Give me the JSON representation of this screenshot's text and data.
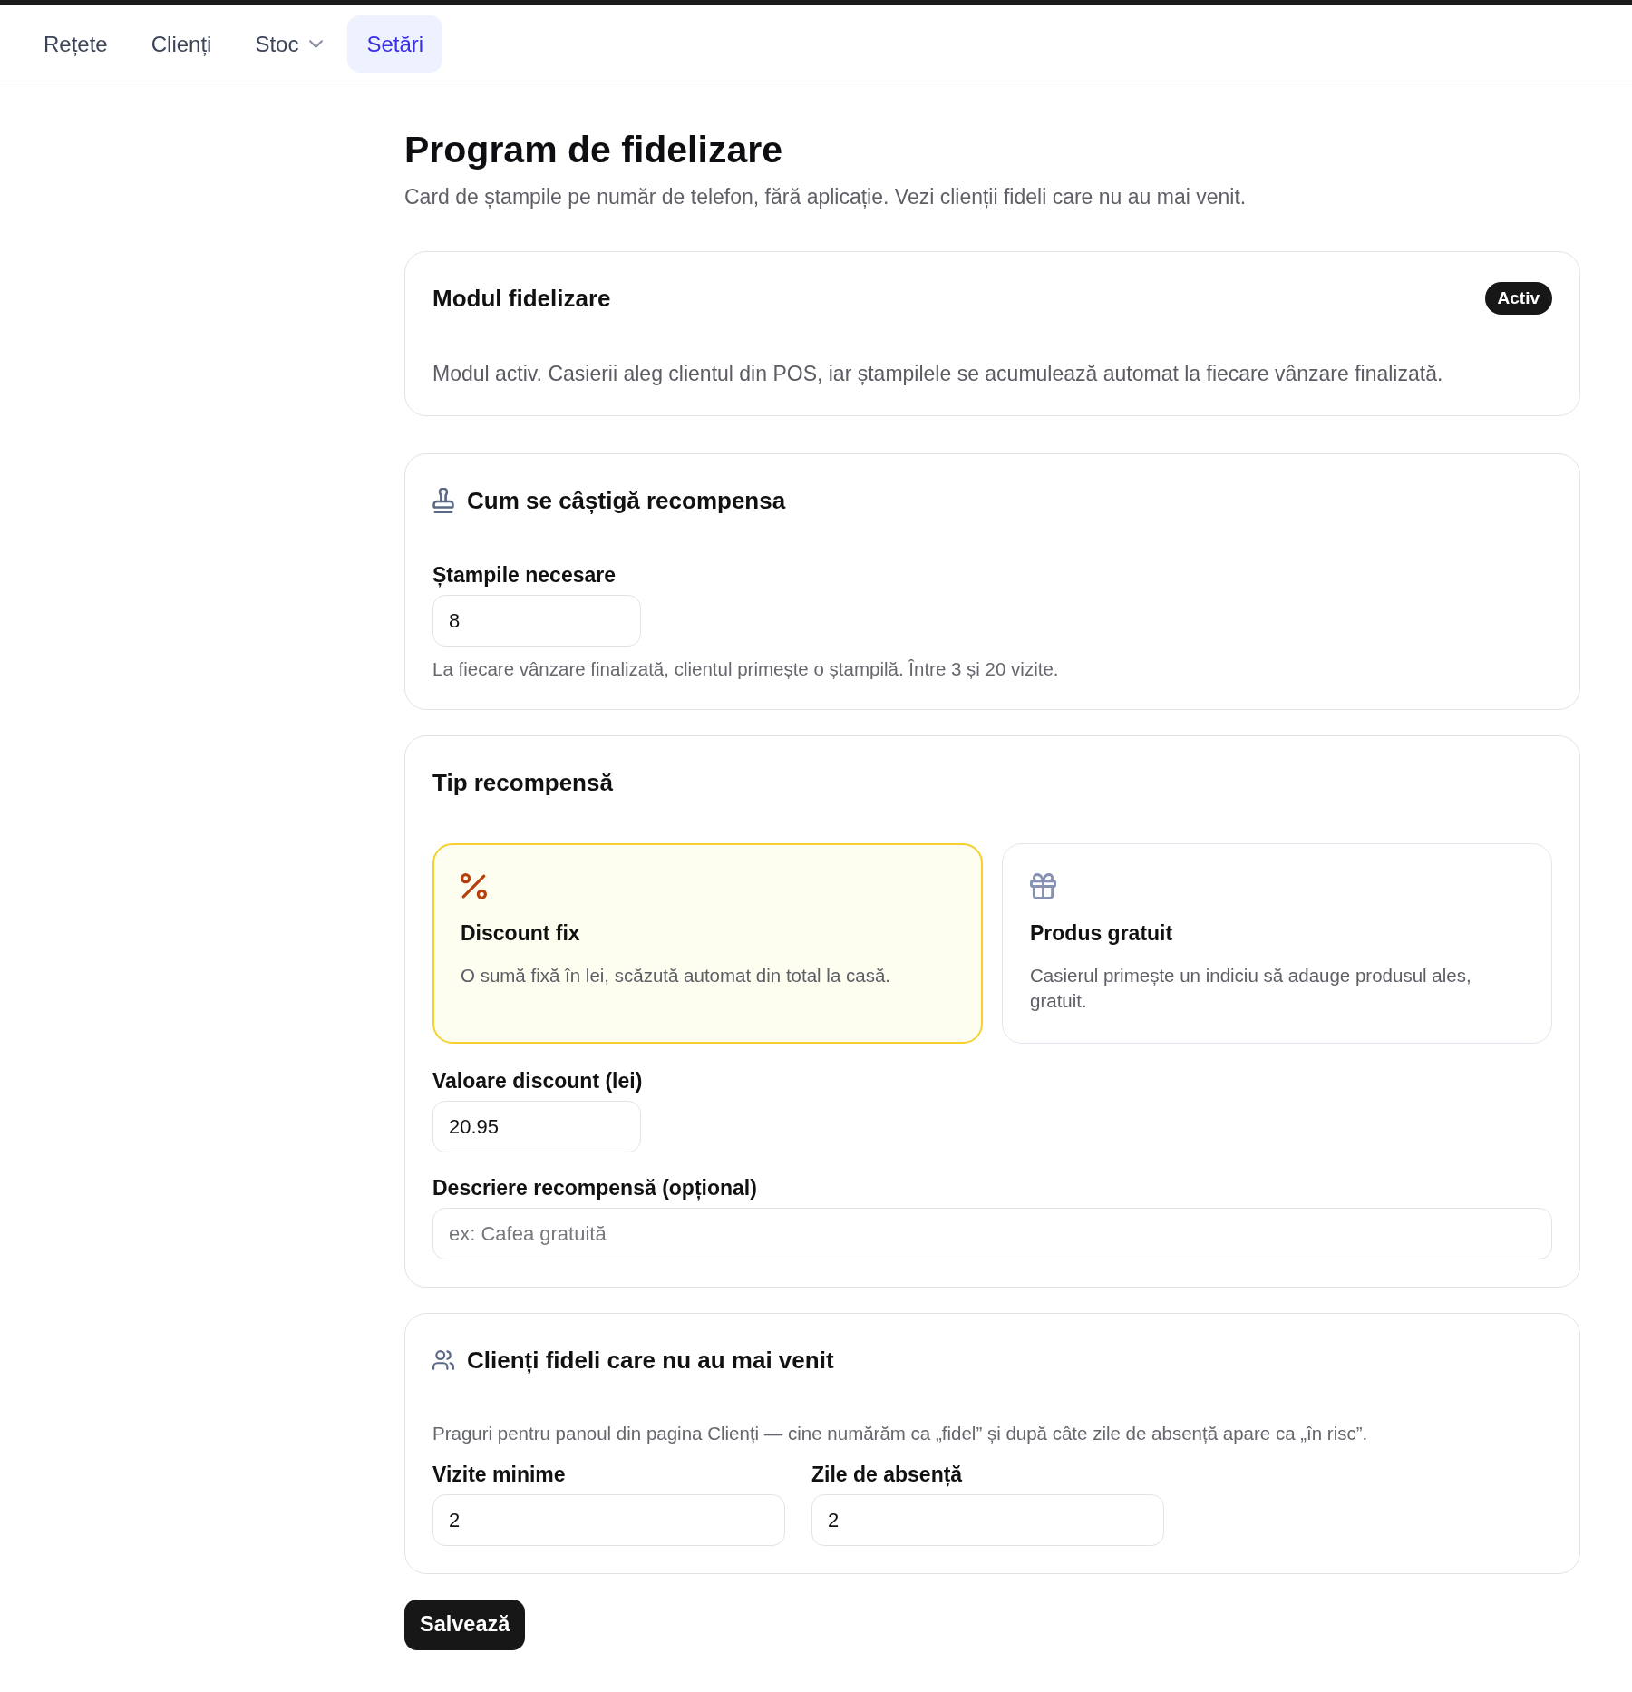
{
  "nav": {
    "items": [
      {
        "label": "Rețete",
        "selected": false,
        "dropdown": false
      },
      {
        "label": "Clienți",
        "selected": false,
        "dropdown": false
      },
      {
        "label": "Stoc",
        "selected": false,
        "dropdown": true
      },
      {
        "label": "Setări",
        "selected": true,
        "dropdown": false
      }
    ]
  },
  "page": {
    "title": "Program de fidelizare",
    "subtitle": "Card de ștampile pe număr de telefon, fără aplicație. Vezi clienții fideli care nu au mai venit."
  },
  "module_card": {
    "title": "Modul fidelizare",
    "badge": "Activ",
    "description": "Modul activ. Casierii aleg clientul din POS, iar ștampilele se acumulează automat la fiecare vânzare finalizată."
  },
  "earn_card": {
    "title": "Cum se câștigă recompensa",
    "fields": [
      {
        "kind": "number",
        "label": "Ștampile necesare",
        "value": "8",
        "help": "La fiecare vânzare finalizată, clientul primește o ștampilă. Între 3 și 20 vizite."
      }
    ]
  },
  "reward_card": {
    "title": "Tip recompensă",
    "options": [
      {
        "kind": "discount",
        "title": "Discount fix",
        "description": "O sumă fixă în lei, scăzută automat din total la casă.",
        "selected": true
      },
      {
        "kind": "product",
        "title": "Produs gratuit",
        "description": "Casierul primește un indiciu să adauge produsul ales, gratuit.",
        "selected": false
      }
    ],
    "fields": [
      {
        "kind": "number",
        "label": "Valoare discount (lei)",
        "value": "20.95"
      },
      {
        "kind": "text",
        "label": "Descriere recompensă (opțional)",
        "placeholder": "ex: Cafea gratuită"
      }
    ]
  },
  "loyal_card": {
    "title": "Clienți fideli care nu au mai venit",
    "description": "Praguri pentru panoul din pagina Clienți — cine numărăm ca „fidel” și după câte zile de absență apare ca „în risc”.",
    "fields": [
      {
        "kind": "number",
        "label": "Vizite minime",
        "value": "2"
      },
      {
        "kind": "number",
        "label": "Zile de absență",
        "value": "2"
      }
    ]
  },
  "save_button": {
    "label": "Salvează"
  }
}
